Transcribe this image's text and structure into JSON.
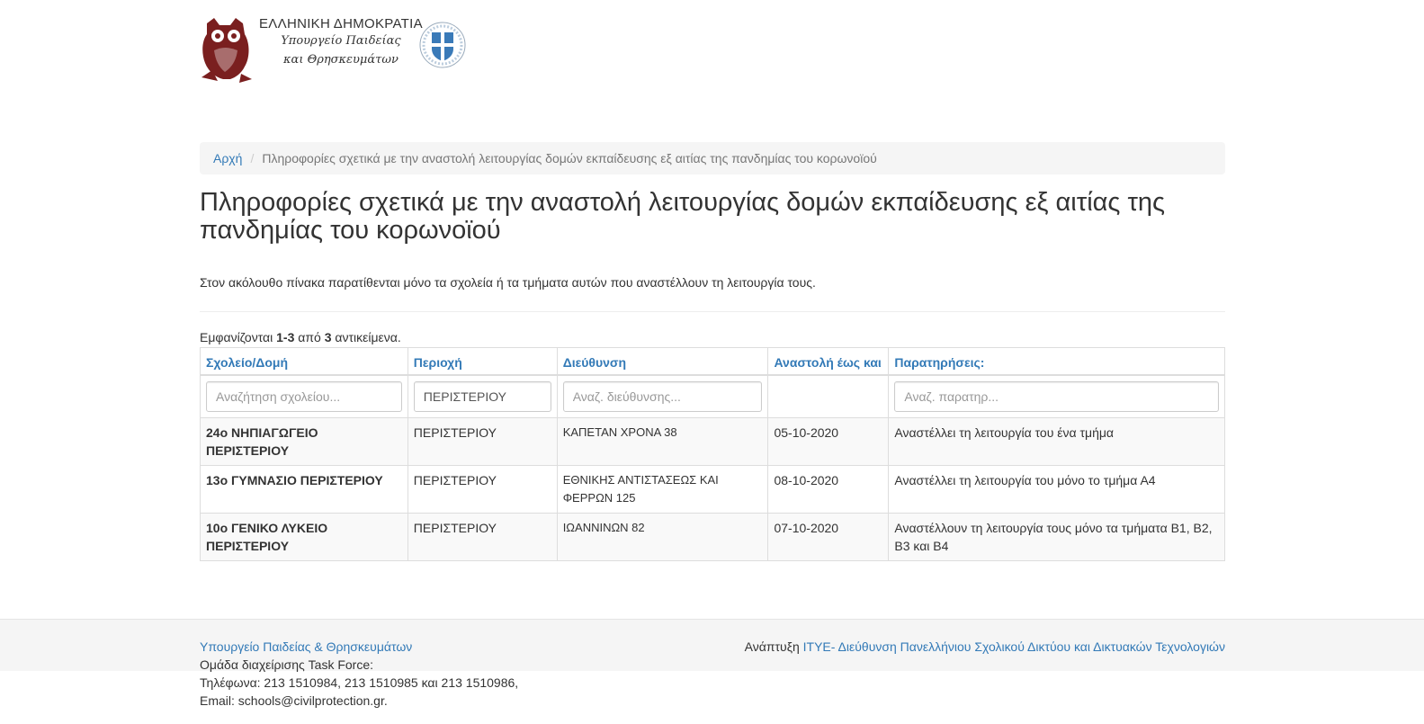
{
  "header": {
    "ministry_title": "ΕΛΛΗΝΙΚΗ ΔΗΜΟΚΡΑΤΙΑ",
    "ministry_line1": "Υπουργείο Παιδείας",
    "ministry_line2": "και Θρησκευμάτων",
    "owl_color": "#7a1f1f",
    "emblem_color": "#3a7ab8"
  },
  "breadcrumb": {
    "home": "Αρχή",
    "current": "Πληροφορίες σχετικά με την αναστολή λειτουργίας δομών εκπαίδευσης εξ αιτίας της πανδημίας του κορωνοϊού"
  },
  "page": {
    "title_line1": "Πληροφορίες σχετικά με την αναστολή λειτουργίας δομών εκπαίδευσης εξ αιτίας της",
    "title_line2": "πανδημίας του κορωνοϊού",
    "intro": "Στον ακόλουθο πίνακα παρατίθενται μόνο τα σχολεία ή τα τμήματα αυτών που αναστέλλουν τη λειτουργία τους.",
    "summary_prefix": "Εμφανίζονται ",
    "summary_range": "1-3",
    "summary_mid": " από ",
    "summary_total": "3",
    "summary_suffix": " αντικείμενα."
  },
  "table": {
    "columns": [
      "Σχολείο/Δομή",
      "Περιοχή",
      "Διεύθυνση",
      "Αναστολή έως και",
      "Παρατηρήσεις:"
    ],
    "filters": {
      "school_placeholder": "Αναζήτηση σχολείου...",
      "area_value": "ΠΕΡΙΣΤΕΡΙΟΥ",
      "address_placeholder": "Αναζ. διεύθυνσης...",
      "notes_placeholder": "Αναζ. παρατηρ..."
    },
    "rows": [
      {
        "school": "24ο ΝΗΠΙΑΓΩΓΕΙΟ ΠΕΡΙΣΤΕΡΙΟΥ",
        "area": "ΠΕΡΙΣΤΕΡΙΟΥ",
        "address": "ΚΑΠΕΤΑΝ ΧΡΟΝΑ 38",
        "until": "05-10-2020",
        "notes": "Αναστέλλει τη λειτουργία του ένα τμήμα"
      },
      {
        "school": "13ο ΓΥΜΝΑΣΙΟ ΠΕΡΙΣΤΕΡΙΟΥ",
        "area": "ΠΕΡΙΣΤΕΡΙΟΥ",
        "address": "ΕΘΝΙΚΗΣ ΑΝΤΙΣΤΑΣΕΩΣ ΚΑΙ ΦΕΡΡΩΝ 125",
        "until": "08-10-2020",
        "notes": "Αναστέλλει τη λειτουργία του μόνο το τμήμα Α4"
      },
      {
        "school": "10ο ΓΕΝΙΚΟ ΛΥΚΕΙΟ ΠΕΡΙΣΤΕΡΙΟΥ",
        "area": "ΠΕΡΙΣΤΕΡΙΟΥ",
        "address": "ΙΩΑΝΝΙΝΩΝ 82",
        "until": "07-10-2020",
        "notes": "Αναστέλλουν τη λειτουργία τους μόνο τα τμήματα Β1, Β2, Β3 και Β4"
      }
    ]
  },
  "footer": {
    "ministry_link": "Υπουργείο Παιδείας & Θρησκευμάτων",
    "team": "Ομάδα διαχείρισης Task Force:",
    "phones": "Τηλέφωνα: 213 1510984, 213 1510985 και 213 1510986,",
    "email": "Email: schools@civilprotection.gr.",
    "dev_prefix": "Ανάπτυξη ",
    "dev_org": "ΙΤΥΕ",
    "dev_link": "- Διεύθυνση Πανελλήνιου Σχολικού Δικτύου και Δικτυακών Τεχνολογιών"
  },
  "colors": {
    "link": "#337ab7",
    "text": "#333333",
    "breadcrumb_bg": "#f5f5f5"
  }
}
